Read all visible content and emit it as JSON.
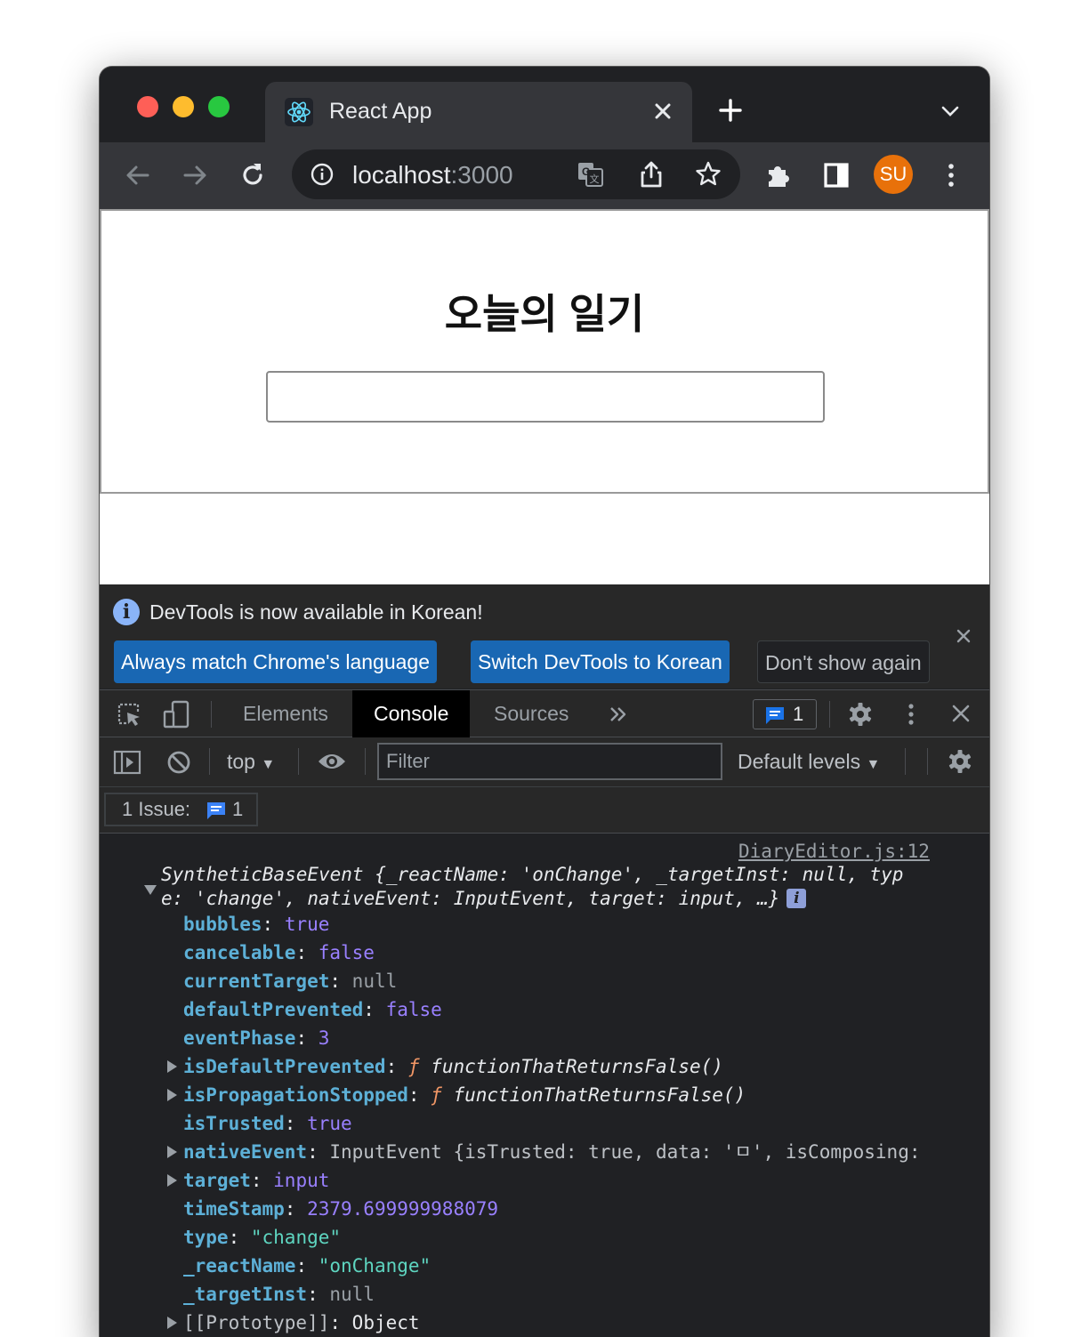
{
  "browser": {
    "tab": {
      "title": "React App"
    },
    "address": {
      "host": "localhost",
      "port": ":3000"
    },
    "profile_initials": "SU"
  },
  "page": {
    "title": "오늘의 일기",
    "author_input_value": ""
  },
  "devtools": {
    "infobar": {
      "message": "DevTools is now available in Korean!",
      "buttons": [
        "Always match Chrome's language",
        "Switch DevTools to Korean",
        "Don't show again"
      ]
    },
    "tabs": [
      "Elements",
      "Console",
      "Sources"
    ],
    "active_tab": "Console",
    "issues_count": "1",
    "console_toolbar": {
      "context": "top",
      "filter_placeholder": "Filter",
      "levels": "Default levels"
    },
    "issues_bar": {
      "label": "1 Issue:",
      "count": "1"
    },
    "console": {
      "source_link": "DiaryEditor.js:12",
      "summary": {
        "line1": "SyntheticBaseEvent {_reactName: 'onChange', _targetInst: null, typ",
        "line2": "e: 'change', nativeEvent: InputEvent, target: input, …}"
      },
      "props": [
        {
          "key": "bubbles",
          "value": "true",
          "kind": "bool",
          "expandable": false
        },
        {
          "key": "cancelable",
          "value": "false",
          "kind": "bool",
          "expandable": false
        },
        {
          "key": "currentTarget",
          "value": "null",
          "kind": "null",
          "expandable": false
        },
        {
          "key": "defaultPrevented",
          "value": "false",
          "kind": "bool",
          "expandable": false
        },
        {
          "key": "eventPhase",
          "value": "3",
          "kind": "number",
          "expandable": false
        },
        {
          "key": "isDefaultPrevented",
          "value": "functionThatReturnsFalse()",
          "kind": "function",
          "expandable": true
        },
        {
          "key": "isPropagationStopped",
          "value": "functionThatReturnsFalse()",
          "kind": "function",
          "expandable": true
        },
        {
          "key": "isTrusted",
          "value": "true",
          "kind": "bool",
          "expandable": false
        },
        {
          "key": "nativeEvent",
          "value": "InputEvent {isTrusted: true, data: 'ㅁ', isComposing:",
          "kind": "object",
          "expandable": true
        },
        {
          "key": "target",
          "value": "input",
          "kind": "node",
          "expandable": true
        },
        {
          "key": "timeStamp",
          "value": "2379.699999988079",
          "kind": "number",
          "expandable": false
        },
        {
          "key": "type",
          "value": "\"change\"",
          "kind": "string",
          "expandable": false
        },
        {
          "key": "_reactName",
          "value": "\"onChange\"",
          "kind": "string",
          "expandable": false
        },
        {
          "key": "_targetInst",
          "value": "null",
          "kind": "null",
          "expandable": false
        },
        {
          "key": "[[Prototype]]",
          "value": "Object",
          "kind": "proto",
          "expandable": true
        }
      ]
    }
  },
  "colors": {
    "chrome_dark": "#202124",
    "chrome_toolbar": "#35363a",
    "devtools_button_blue": "#1967b3",
    "profile_orange": "#e8710a",
    "console_key": "#5db0d7",
    "console_keyword": "#9980ff"
  }
}
